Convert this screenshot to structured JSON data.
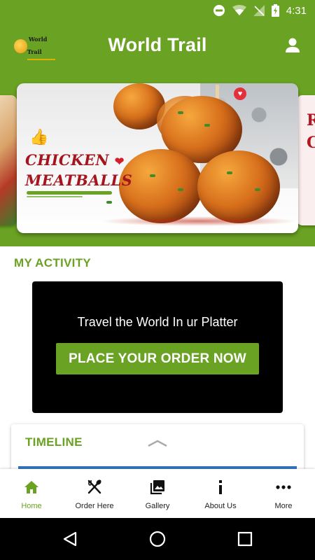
{
  "status_bar": {
    "time": "4:31"
  },
  "header": {
    "title": "World Trail",
    "logo_text": "World Trail"
  },
  "banner": {
    "title_line1": "CHICKEN",
    "title_line2": "MEATBALLS",
    "right_card_text": "R C"
  },
  "activity": {
    "section_title": "MY ACTIVITY",
    "tagline": "Travel the World In ur Platter",
    "cta_label": "PLACE YOUR ORDER NOW"
  },
  "timeline": {
    "title": "TIMELINE"
  },
  "bottom_nav": {
    "items": [
      {
        "label": "Home",
        "icon": "home-icon",
        "active": true
      },
      {
        "label": "Order Here",
        "icon": "utensils-icon",
        "active": false
      },
      {
        "label": "Gallery",
        "icon": "gallery-icon",
        "active": false
      },
      {
        "label": "About Us",
        "icon": "info-icon",
        "active": false
      },
      {
        "label": "More",
        "icon": "more-icon",
        "active": false
      }
    ]
  },
  "colors": {
    "brand_green": "#6aa223",
    "cta_background": "#000000",
    "banner_red": "#a4151d"
  }
}
